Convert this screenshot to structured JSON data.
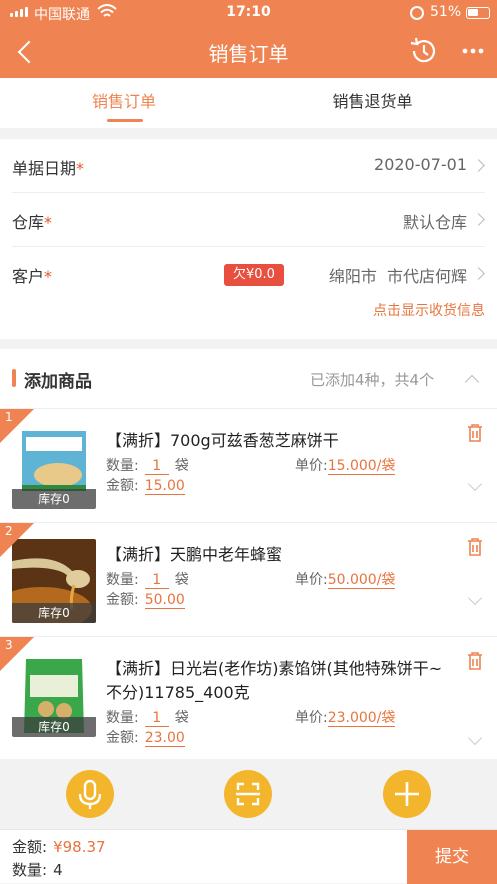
{
  "status_bar": {
    "carrier": "中国联通",
    "time": "17:10",
    "battery": "51%"
  },
  "header": {
    "title": "销售订单"
  },
  "tabs": [
    {
      "label": "销售订单",
      "active": true
    },
    {
      "label": "销售退货单",
      "active": false
    }
  ],
  "form": {
    "date": {
      "label": "单据日期",
      "required": "*",
      "value": "2020-07-01"
    },
    "warehouse": {
      "label": "仓库",
      "required": "*",
      "value": "默认仓库"
    },
    "customer": {
      "label": "客户",
      "required": "*",
      "debt": "欠¥0.0",
      "value": "绵阳市  市代店何辉"
    },
    "address_link": "点击显示收货信息"
  },
  "products": {
    "title": "添加商品",
    "summary": "已添加4种，共4个",
    "items": [
      {
        "index": "1",
        "name": "【满折】700g可兹香葱芝麻饼干",
        "qty_label": "数量:",
        "qty": "1",
        "unit": "袋",
        "price_label": "单价:",
        "price": "15.000/袋",
        "amount_label": "金额:",
        "amount": "15.00",
        "stock": "库存0"
      },
      {
        "index": "2",
        "name": "【满折】天鹏中老年蜂蜜",
        "qty_label": "数量:",
        "qty": "1",
        "unit": "袋",
        "price_label": "单价:",
        "price": "50.000/袋",
        "amount_label": "金额:",
        "amount": "50.00",
        "stock": "库存0"
      },
      {
        "index": "3",
        "name": "【满折】日光岩(老作坊)素馅饼(其他特殊饼干~不分)11785_400克",
        "qty_label": "数量:",
        "qty": "1",
        "unit": "袋",
        "price_label": "单价:",
        "price": "23.000/袋",
        "amount_label": "金额:",
        "amount": "23.00",
        "stock": "库存0"
      }
    ]
  },
  "footer": {
    "amount_label": "金额:",
    "amount": "¥98.37",
    "count_label": "数量:",
    "count": "4",
    "submit": "提交"
  },
  "colors": {
    "primary": "#ef8452",
    "accent": "#e8743f",
    "fab": "#f3b52b",
    "debt": "#e94f3f"
  },
  "icons": [
    "back-icon",
    "history-icon",
    "more-icon",
    "trash-icon",
    "mic-icon",
    "scan-icon",
    "plus-icon"
  ]
}
